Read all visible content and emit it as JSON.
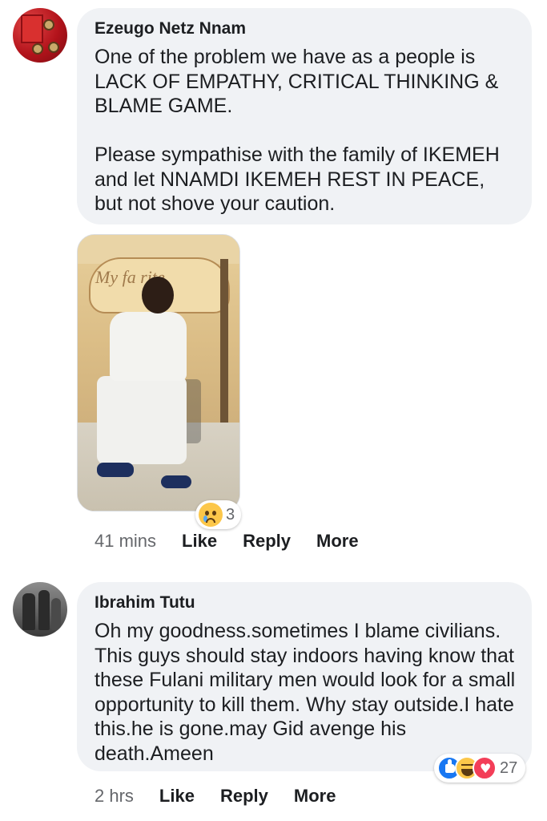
{
  "comments": [
    {
      "author": "Ezeugo Netz Nnam",
      "text": "One of the problem we have as a people is LACK OF EMPATHY, CRITICAL THINKING & BLAME GAME.\n\nPlease sympathise with the family of IKEMEH and let NNAMDI IKEMEH REST IN PEACE, but not shove your caution.",
      "photo_sign_text": "My fa    rite",
      "reaction_count": "3",
      "reaction_icons": [
        "sad-emoji-icon"
      ],
      "time": "41 mins",
      "actions": {
        "like": "Like",
        "reply": "Reply",
        "more": "More"
      }
    },
    {
      "author": "Ibrahim Tutu",
      "text": "Oh my goodness.sometimes I blame civilians. This guys should stay indoors having know that these Fulani military men would look for a small opportunity to kill them. Why stay outside.I hate this.he is gone.may Gid avenge his death.Ameen",
      "reaction_count": "27",
      "reaction_icons": [
        "like-icon",
        "haha-emoji-icon",
        "love-icon"
      ],
      "time": "2 hrs",
      "actions": {
        "like": "Like",
        "reply": "Reply",
        "more": "More"
      }
    }
  ],
  "colors": {
    "bubble_bg": "#f0f2f5",
    "text": "#1c1e21",
    "meta_text": "#65676b",
    "like_blue": "#1877f2",
    "love_red": "#f33e58",
    "emoji_yellow": "#fcc74a"
  }
}
